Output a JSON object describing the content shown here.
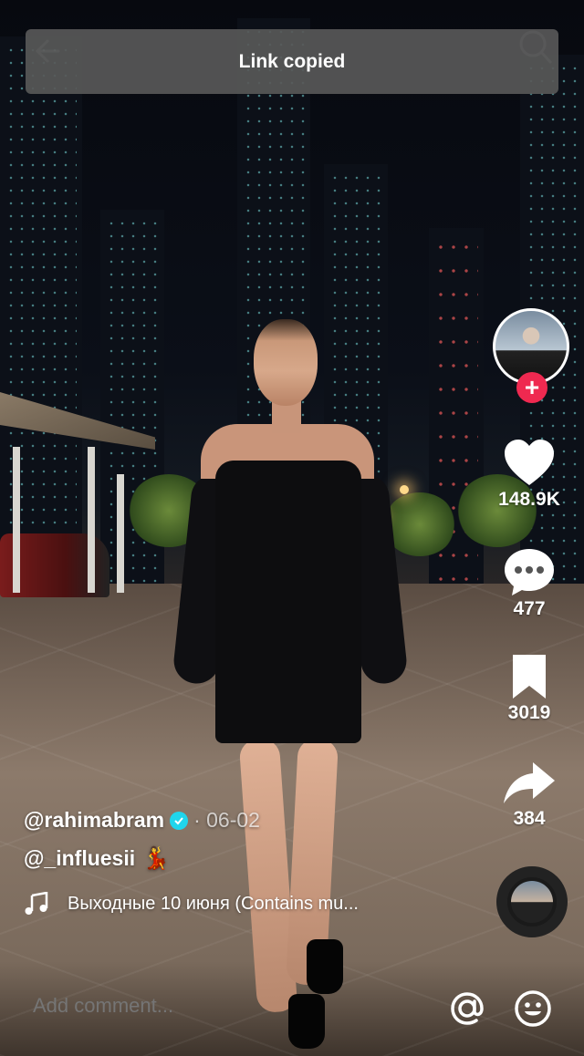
{
  "toast": {
    "text": "Link copied"
  },
  "actions": {
    "likes": "148.9K",
    "comments": "477",
    "bookmarks": "3019",
    "shares": "384"
  },
  "post": {
    "username": "@rahimabram",
    "date": "· 06-02",
    "mention": "@_influesii",
    "mention_emoji": "💃",
    "music": "Выходные 10 июня (Contains mu..."
  },
  "comment_bar": {
    "placeholder": "Add comment..."
  },
  "colors": {
    "accent": "#ef2950",
    "verified": "#20d5ec",
    "toast_bg": "#585858"
  }
}
